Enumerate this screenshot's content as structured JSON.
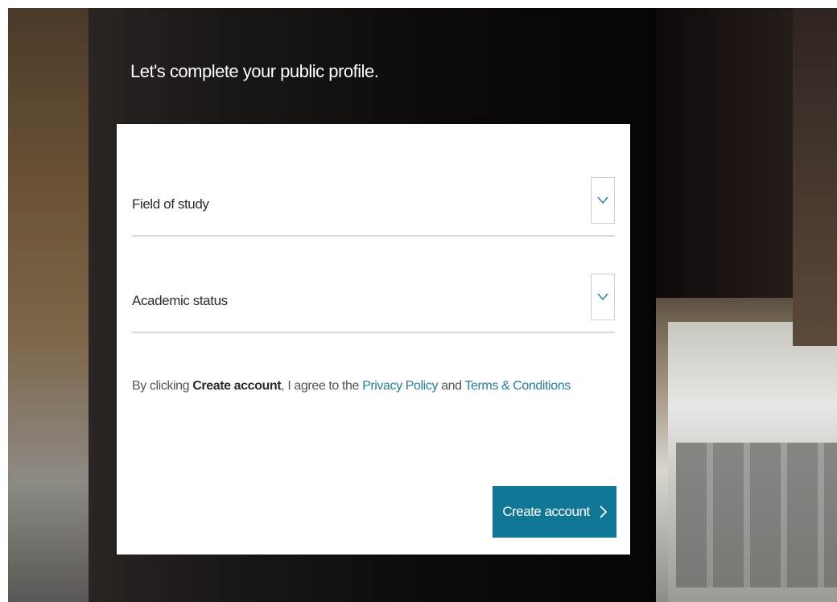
{
  "page": {
    "headline": "Let's complete your public profile."
  },
  "form": {
    "fields": [
      {
        "label": "Field of study",
        "icon": "chevron-down-icon"
      },
      {
        "label": "Academic status",
        "icon": "chevron-down-icon"
      }
    ],
    "terms": {
      "prefix": "By clicking ",
      "bold": "Create account",
      "middle": ", I agree to the ",
      "privacy_link": "Privacy Policy",
      "and": " and ",
      "terms_link": "Terms & Conditions"
    },
    "submit": {
      "label": "Create account",
      "icon": "chevron-right-icon"
    }
  },
  "colors": {
    "accent": "#117797",
    "link": "#2a7d9e",
    "card_background": "#ffffff"
  }
}
